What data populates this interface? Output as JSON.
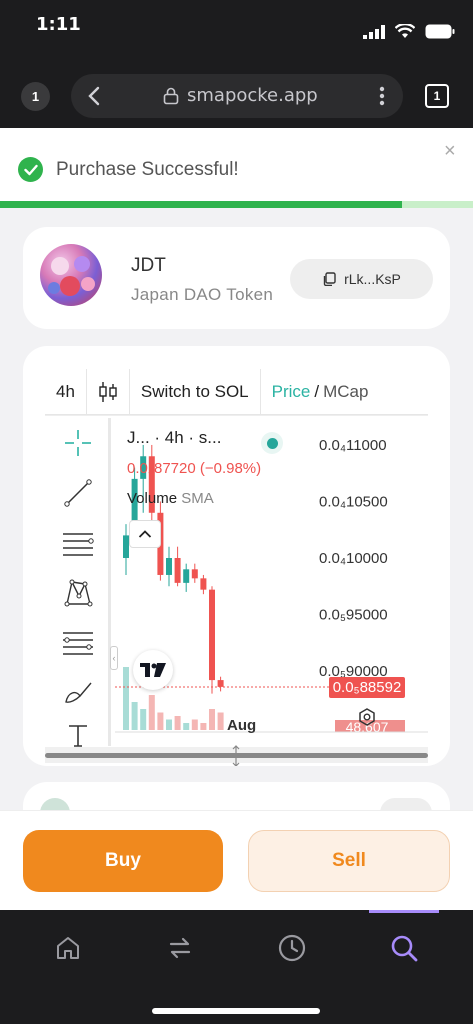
{
  "status_bar": {
    "time": "1:11"
  },
  "browser": {
    "tab_count_left": "1",
    "url": "smapocke.app",
    "tab_count_right": "1"
  },
  "toast": {
    "message": "Purchase Successful!",
    "close": "×",
    "progress": 0.85
  },
  "token": {
    "symbol": "JDT",
    "name": "Japan DAO Token",
    "address": "rLk...KsP"
  },
  "chart_toolbar": {
    "interval": "4h",
    "switch_label": "Switch to SOL",
    "price_label": "Price",
    "separator": "/",
    "mcap_label": "MCap"
  },
  "chart": {
    "legend_title": "J... · 4h · s...",
    "ohlc_change": "0.0₄87720 (−0.98%)",
    "volume_label": "Volume",
    "sma_label": "SMA",
    "collapse_icon": "chevron-up-icon",
    "x_tick": "Aug",
    "price_tag": "0.0₅88592",
    "volume_tag": "48.607"
  },
  "chart_data": {
    "type": "candlestick",
    "y_ticks": [
      "0.0₄11000",
      "0.0₄10500",
      "0.0₄10000",
      "0.0₅95000",
      "0.0₅90000"
    ],
    "y_tick_values": [
      0.00011,
      0.000105,
      0.0001,
      9.5e-05,
      9e-05
    ],
    "ylim": [
      8.85e-05,
      0.0001115
    ],
    "last_price": 8.8592e-05,
    "candles": [
      {
        "o": 0.0001,
        "h": 0.000103,
        "l": 9.85e-05,
        "c": 0.000102,
        "dir": "up"
      },
      {
        "o": 0.000102,
        "h": 0.000108,
        "l": 0.000101,
        "c": 0.000107,
        "dir": "up"
      },
      {
        "o": 0.000107,
        "h": 0.00011,
        "l": 0.000104,
        "c": 0.000109,
        "dir": "up"
      },
      {
        "o": 0.000109,
        "h": 0.00011,
        "l": 0.000103,
        "c": 0.000104,
        "dir": "down"
      },
      {
        "o": 0.000104,
        "h": 0.000105,
        "l": 9.8e-05,
        "c": 9.85e-05,
        "dir": "down"
      },
      {
        "o": 9.85e-05,
        "h": 0.000101,
        "l": 9.75e-05,
        "c": 0.0001,
        "dir": "up"
      },
      {
        "o": 0.0001,
        "h": 0.000101,
        "l": 9.75e-05,
        "c": 9.78e-05,
        "dir": "down"
      },
      {
        "o": 9.78e-05,
        "h": 9.95e-05,
        "l": 9.7e-05,
        "c": 9.9e-05,
        "dir": "up"
      },
      {
        "o": 9.9e-05,
        "h": 9.95e-05,
        "l": 9.78e-05,
        "c": 9.82e-05,
        "dir": "down"
      },
      {
        "o": 9.82e-05,
        "h": 9.85e-05,
        "l": 9.68e-05,
        "c": 9.72e-05,
        "dir": "down"
      },
      {
        "o": 9.72e-05,
        "h": 9.75e-05,
        "l": 8.8e-05,
        "c": 8.92e-05,
        "dir": "down"
      },
      {
        "o": 8.92e-05,
        "h": 8.95e-05,
        "l": 8.82e-05,
        "c": 8.86e-05,
        "dir": "down"
      }
    ],
    "volumes": [
      0.9,
      0.4,
      0.3,
      0.5,
      0.25,
      0.15,
      0.2,
      0.1,
      0.15,
      0.1,
      0.3,
      0.25
    ]
  },
  "actions": {
    "buy": "Buy",
    "sell": "Sell"
  },
  "nav": {
    "items": [
      "home-icon",
      "swap-icon",
      "history-icon",
      "search-icon"
    ],
    "active": "search-icon"
  },
  "colors": {
    "accent_orange": "#f0891e",
    "up": "#26a69a",
    "down": "#ef5350",
    "success": "#2fb34d",
    "nav_active": "#a78bfa"
  }
}
